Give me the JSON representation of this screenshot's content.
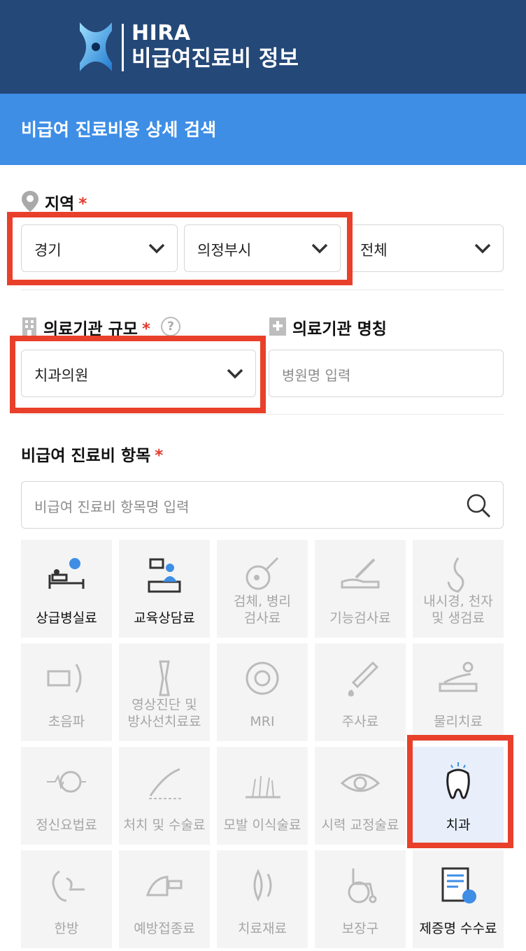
{
  "header": {
    "brand_line1": "HIRA",
    "brand_line2": "비급여진료비 정보",
    "brand_color": "#244878"
  },
  "subheader": {
    "title": "비급여 진료비용 상세 검색",
    "color": "#3e8ee6"
  },
  "region": {
    "label": "지역",
    "required_mark": "*",
    "province": "경기",
    "city": "의정부시",
    "district": "전체"
  },
  "institution_scale": {
    "label": "의료기관 규모",
    "required_mark": "*",
    "help": "?",
    "value": "치과의원"
  },
  "institution_name": {
    "label": "의료기관 명칭",
    "placeholder": "병원명 입력"
  },
  "items": {
    "label": "비급여 진료비 항목",
    "required_mark": "*",
    "search_placeholder": "비급여 진료비 항목명 입력",
    "tiles": [
      {
        "line1": "상급병실료",
        "line2": "",
        "icon": "hospital-bed-icon",
        "active": true
      },
      {
        "line1": "교육상담료",
        "line2": "",
        "icon": "counseling-icon",
        "active": true
      },
      {
        "line1": "검체, 병리",
        "line2": "검사료",
        "icon": "specimen-icon",
        "active": false
      },
      {
        "line1": "기능검사료",
        "line2": "",
        "icon": "function-test-icon",
        "active": false
      },
      {
        "line1": "내시경, 천자",
        "line2": "및 생검료",
        "icon": "endoscope-icon",
        "active": false
      },
      {
        "line1": "초음파",
        "line2": "",
        "icon": "ultrasound-icon",
        "active": false
      },
      {
        "line1": "영상진단 및",
        "line2": "방사선치료료",
        "icon": "xray-icon",
        "active": false
      },
      {
        "line1": "MRI",
        "line2": "",
        "icon": "mri-icon",
        "active": false
      },
      {
        "line1": "주사료",
        "line2": "",
        "icon": "syringe-icon",
        "active": false
      },
      {
        "line1": "물리치료",
        "line2": "",
        "icon": "physical-therapy-icon",
        "active": false
      },
      {
        "line1": "정신요법료",
        "line2": "",
        "icon": "brain-icon",
        "active": false
      },
      {
        "line1": "처치 및 수술료",
        "line2": "",
        "icon": "surgery-icon",
        "active": false
      },
      {
        "line1": "모발 이식술료",
        "line2": "",
        "icon": "hair-icon",
        "active": false
      },
      {
        "line1": "시력 교정술료",
        "line2": "",
        "icon": "eye-icon",
        "active": false
      },
      {
        "line1": "치과",
        "line2": "",
        "icon": "tooth-icon",
        "active": true,
        "selected": true
      },
      {
        "line1": "한방",
        "line2": "",
        "icon": "acupuncture-icon",
        "active": false
      },
      {
        "line1": "예방접종료",
        "line2": "",
        "icon": "vaccine-icon",
        "active": false
      },
      {
        "line1": "치료재료",
        "line2": "",
        "icon": "lens-icon",
        "active": false
      },
      {
        "line1": "보장구",
        "line2": "",
        "icon": "wheelchair-icon",
        "active": false
      },
      {
        "line1": "제증명 수수료",
        "line2": "",
        "icon": "certificate-icon",
        "active": true
      }
    ]
  },
  "highlight_color": "#e8402a"
}
